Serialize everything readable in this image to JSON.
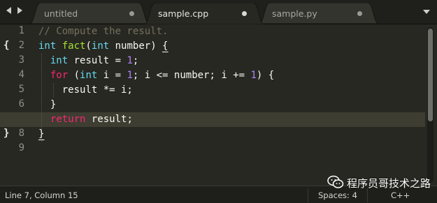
{
  "tabs": [
    {
      "label": "untitled",
      "active": false
    },
    {
      "label": "sample.cpp",
      "active": true
    },
    {
      "label": "sample.py",
      "active": false
    }
  ],
  "gutter": {
    "line_numbers": [
      "1",
      "2",
      "3",
      "4",
      "5",
      "6",
      "7",
      "8",
      "9"
    ],
    "fold_markers": {
      "open": "{",
      "close": "}"
    },
    "current_line": "7"
  },
  "code": {
    "lines": [
      [
        {
          "t": "// Compute the result.",
          "k": "comment"
        }
      ],
      [
        {
          "t": "int",
          "k": "type"
        },
        {
          "t": " ",
          "k": "plain"
        },
        {
          "t": "fact",
          "k": "func"
        },
        {
          "t": "(",
          "k": "plain"
        },
        {
          "t": "int",
          "k": "type"
        },
        {
          "t": " number) ",
          "k": "plain"
        },
        {
          "t": "{",
          "k": "brace"
        }
      ],
      [
        {
          "t": "  ",
          "k": "plain"
        },
        {
          "t": "int",
          "k": "type"
        },
        {
          "t": " result = ",
          "k": "plain"
        },
        {
          "t": "1",
          "k": "number"
        },
        {
          "t": ";",
          "k": "plain"
        }
      ],
      [
        {
          "t": "  ",
          "k": "plain"
        },
        {
          "t": "for",
          "k": "keyword"
        },
        {
          "t": " (",
          "k": "plain"
        },
        {
          "t": "int",
          "k": "type"
        },
        {
          "t": " i = ",
          "k": "plain"
        },
        {
          "t": "1",
          "k": "number"
        },
        {
          "t": "; i <= number; i += ",
          "k": "plain"
        },
        {
          "t": "1",
          "k": "number"
        },
        {
          "t": ") {",
          "k": "plain"
        }
      ],
      [
        {
          "t": "    result *= i;",
          "k": "plain"
        }
      ],
      [
        {
          "t": "  }",
          "k": "plain"
        }
      ],
      [
        {
          "t": "  ",
          "k": "plain"
        },
        {
          "t": "return",
          "k": "keyword"
        },
        {
          "t": " result;",
          "k": "plain"
        }
      ],
      [
        {
          "t": "}",
          "k": "brace"
        }
      ],
      []
    ]
  },
  "status": {
    "position": "Line 7, Column 15",
    "indentation": "Spaces: 4",
    "syntax": "C++"
  },
  "watermark": {
    "text": "程序员哥技术之路"
  },
  "colors": {
    "background": "#272822",
    "comment": "#75715e",
    "type": "#66d9ef",
    "function": "#a6e22e",
    "keyword": "#f92672",
    "number": "#ae81ff",
    "text": "#f8f8f2"
  }
}
